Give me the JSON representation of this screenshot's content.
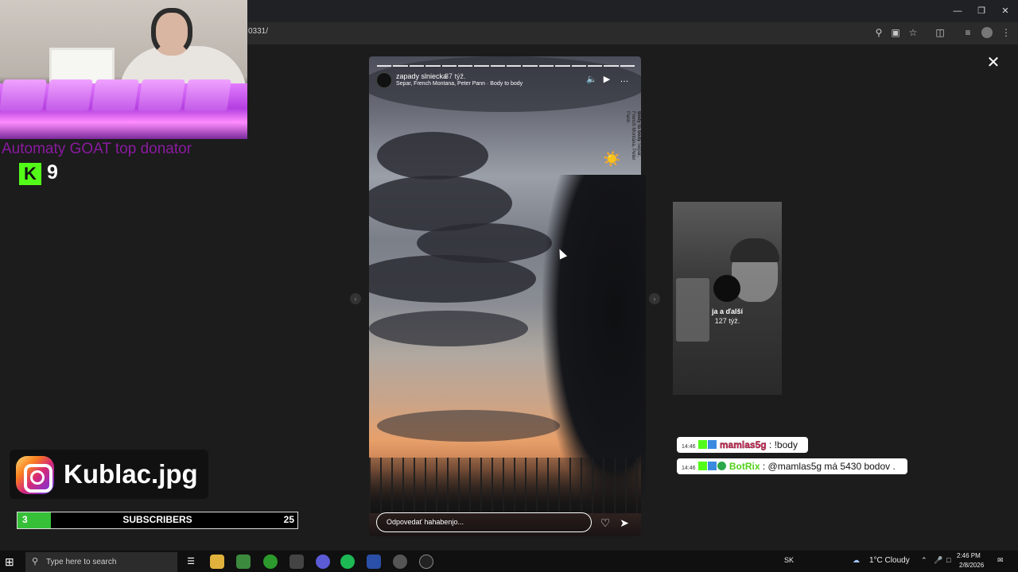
{
  "browser": {
    "url_fragment": "0331/",
    "window_controls": {
      "minimize_icon": "minimize-icon",
      "maximize_icon": "restore-icon",
      "close_icon": "close-icon"
    }
  },
  "stream_overlay": {
    "donator_text": "Automaty GOAT top donator",
    "kick_letter": "K",
    "kick_count": "9",
    "instagram_handle": "Kublac.jpg",
    "subs": {
      "current": "3",
      "label": "SUBSCRIBERS",
      "goal": "25",
      "progress": 0.12
    }
  },
  "story": {
    "username": "zapady slniecka",
    "time_ago": "37 týž.",
    "music": "Separ, French Montana, Peter Pann · Body to body",
    "vertical_song_title": "Body to body",
    "vertical_song_artists": "Separ, French Montana, Peter Pann",
    "sticker": "☀️",
    "reply_placeholder": "Odpovedať hahabenjo...",
    "segments": 16
  },
  "next_story": {
    "name": "ja a ďalší",
    "time_ago": "127 týž."
  },
  "chat": [
    {
      "time": "14:46",
      "user": "mamlas5g",
      "sep": " :",
      "message": " !body"
    },
    {
      "time": "14:46",
      "user": "BotRix",
      "sep": " :",
      "message": " @mamlas5g má 5430 bodov ."
    }
  ],
  "taskbar": {
    "search_placeholder": "Type here to search",
    "lang": "SK",
    "weather": "1°C  Cloudy",
    "time": "2:46 PM",
    "date": "2/8/2026"
  },
  "colors": {
    "kick_green": "#53fc18",
    "subs_fill": "#35c038",
    "donator": "#8a1aa0"
  }
}
